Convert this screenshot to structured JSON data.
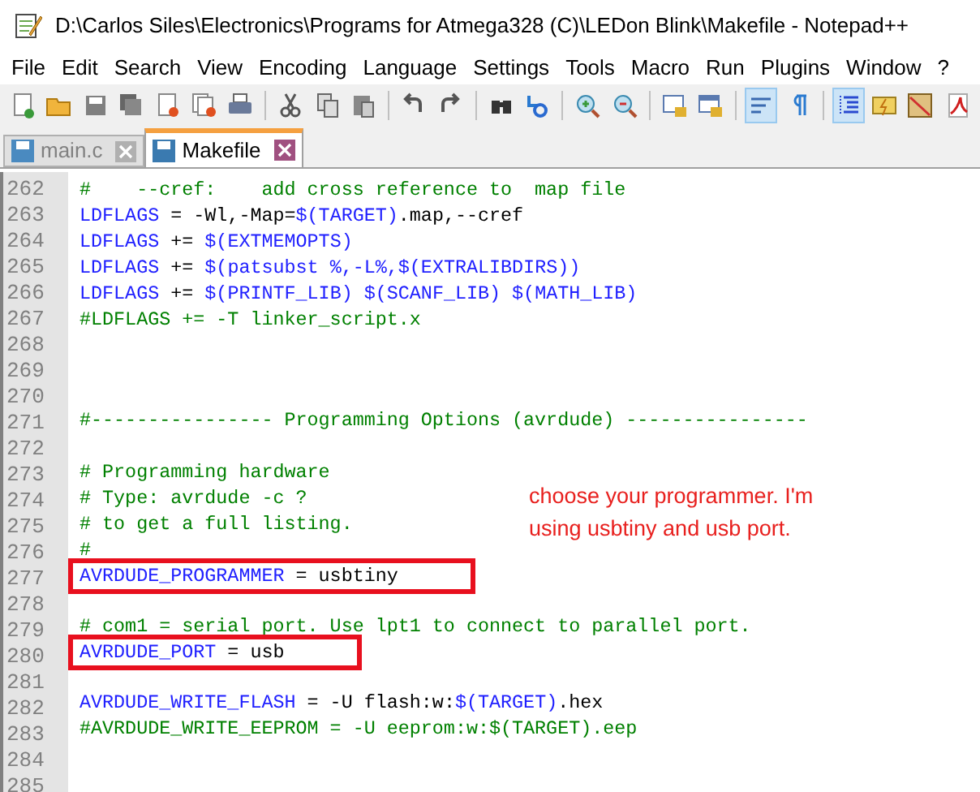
{
  "window": {
    "title": "D:\\Carlos Siles\\Electronics\\Programs for Atmega328 (C)\\LEDon Blink\\Makefile - Notepad++"
  },
  "menu": [
    "File",
    "Edit",
    "Search",
    "View",
    "Encoding",
    "Language",
    "Settings",
    "Tools",
    "Macro",
    "Run",
    "Plugins",
    "Window",
    "?"
  ],
  "toggles": {
    "word_wrap": true,
    "show_all_characters": false,
    "indent_guide": true
  },
  "tabs": [
    {
      "label": "main.c",
      "selected": false
    },
    {
      "label": "Makefile",
      "selected": true
    }
  ],
  "lines": [
    {
      "number": "262",
      "boxed": false,
      "tokens": [
        {
          "kind": "comment",
          "text": "#    --cref:    add cross reference to  map file"
        }
      ]
    },
    {
      "number": "263",
      "boxed": false,
      "tokens": [
        {
          "kind": "keyword",
          "text": "LDFLAGS"
        },
        {
          "kind": "plain",
          "text": " = -Wl,-Map="
        },
        {
          "kind": "keyword",
          "text": "$(TARGET)"
        },
        {
          "kind": "plain",
          "text": ".map,--cref"
        }
      ]
    },
    {
      "number": "264",
      "boxed": false,
      "tokens": [
        {
          "kind": "keyword",
          "text": "LDFLAGS"
        },
        {
          "kind": "plain",
          "text": " += "
        },
        {
          "kind": "keyword",
          "text": "$(EXTMEMOPTS)"
        }
      ]
    },
    {
      "number": "265",
      "boxed": false,
      "tokens": [
        {
          "kind": "keyword",
          "text": "LDFLAGS"
        },
        {
          "kind": "plain",
          "text": " += "
        },
        {
          "kind": "keyword",
          "text": "$(patsubst %,-L%,$(EXTRALIBDIRS))"
        }
      ]
    },
    {
      "number": "266",
      "boxed": false,
      "tokens": [
        {
          "kind": "keyword",
          "text": "LDFLAGS"
        },
        {
          "kind": "plain",
          "text": " += "
        },
        {
          "kind": "keyword",
          "text": "$(PRINTF_LIB) $(SCANF_LIB) $(MATH_LIB)"
        }
      ]
    },
    {
      "number": "267",
      "boxed": false,
      "tokens": [
        {
          "kind": "comment",
          "text": "#LDFLAGS += -T linker_script.x"
        }
      ]
    },
    {
      "number": "268",
      "boxed": false
    },
    {
      "number": "269",
      "boxed": false
    },
    {
      "number": "270",
      "boxed": false
    },
    {
      "number": "271",
      "boxed": false,
      "tokens": [
        {
          "kind": "comment",
          "text": "#---------------- Programming Options (avrdude) ----------------"
        }
      ]
    },
    {
      "number": "272",
      "boxed": false
    },
    {
      "number": "273",
      "boxed": false,
      "tokens": [
        {
          "kind": "comment",
          "text": "# Programming hardware"
        }
      ]
    },
    {
      "number": "274",
      "boxed": false,
      "tokens": [
        {
          "kind": "comment",
          "text": "# Type: avrdude -c ?"
        }
      ]
    },
    {
      "number": "275",
      "boxed": false,
      "tokens": [
        {
          "kind": "comment",
          "text": "# to get a full listing."
        }
      ]
    },
    {
      "number": "276",
      "boxed": false,
      "tokens": [
        {
          "kind": "comment",
          "text": "#"
        }
      ]
    },
    {
      "number": "277",
      "boxed": true,
      "tokens": [
        {
          "kind": "keyword",
          "text": "AVRDUDE_PROGRAMMER"
        },
        {
          "kind": "plain",
          "text": " = usbtiny"
        }
      ]
    },
    {
      "number": "278",
      "boxed": false
    },
    {
      "number": "279",
      "boxed": false,
      "tokens": [
        {
          "kind": "comment",
          "text": "# com1 = serial port. Use lpt1 to connect to parallel port."
        }
      ]
    },
    {
      "number": "280",
      "boxed": true,
      "tokens": [
        {
          "kind": "keyword",
          "text": "AVRDUDE_PORT"
        },
        {
          "kind": "plain",
          "text": " = usb"
        }
      ]
    },
    {
      "number": "281",
      "boxed": false
    },
    {
      "number": "282",
      "boxed": false,
      "tokens": [
        {
          "kind": "keyword",
          "text": "AVRDUDE_WRITE_FLASH"
        },
        {
          "kind": "plain",
          "text": " = -U flash:w:"
        },
        {
          "kind": "keyword",
          "text": "$(TARGET)"
        },
        {
          "kind": "plain",
          "text": ".hex"
        }
      ]
    },
    {
      "number": "283",
      "boxed": false,
      "tokens": [
        {
          "kind": "comment",
          "text": "#AVRDUDE_WRITE_EEPROM = -U eeprom:w:$(TARGET).eep"
        }
      ]
    },
    {
      "number": "284",
      "boxed": false
    },
    {
      "number": "285",
      "boxed": false
    }
  ],
  "annotation": {
    "text": "choose your programmer. I'm using usbtiny and usb port."
  }
}
